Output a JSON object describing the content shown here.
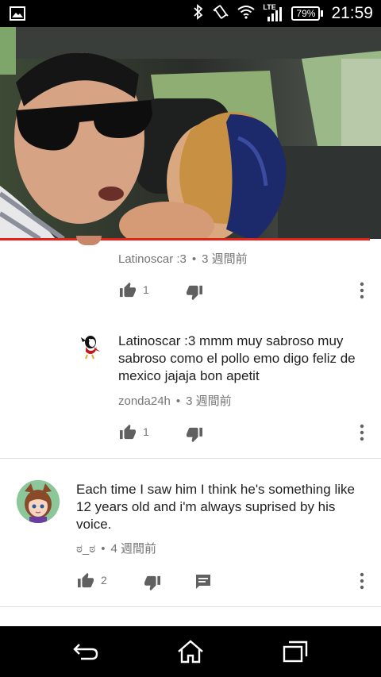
{
  "status_bar": {
    "time": "21:59",
    "battery": "79%",
    "network": "LTE",
    "icons": [
      "gallery-icon",
      "bluetooth-icon",
      "vibrate-icon",
      "wifi-icon",
      "signal-icon",
      "battery-icon"
    ]
  },
  "video": {
    "progress_fraction": 0.97
  },
  "comments": [
    {
      "author": "Latinoscar :3",
      "time": "3 週間前",
      "likes": "1"
    },
    {
      "text": "Latinoscar :3 mmm muy sabroso muy sabroso como el pollo emo digo feliz de mexico jajaja bon apetit",
      "author": "zonda24h",
      "time": "3 週間前",
      "likes": "1"
    },
    {
      "text": "Each time I saw him I think he's something like 12 years old and i'm always suprised by his voice.",
      "author": "ಠ_ಠ",
      "time": "4 週間前",
      "likes": "2"
    }
  ],
  "colors": {
    "progress": "#e62117",
    "text_primary": "#212121",
    "text_secondary": "#757575",
    "icon": "#606060"
  },
  "nav_bar": {
    "icons": [
      "back-icon",
      "home-icon",
      "recents-icon"
    ]
  }
}
